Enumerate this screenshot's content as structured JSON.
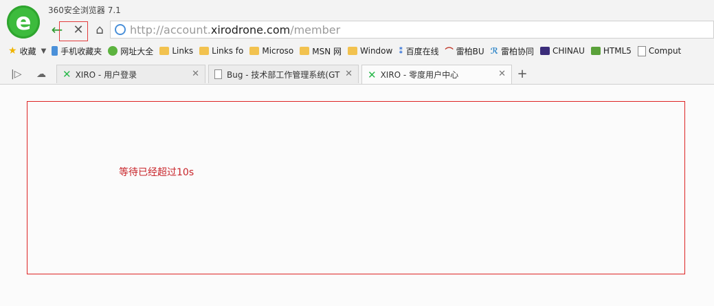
{
  "app": {
    "title": "360安全浏览器 7.1",
    "logo_letter": "e"
  },
  "nav": {
    "back_icon": "←",
    "stop_icon": "✕",
    "home_icon": "⌂"
  },
  "address": {
    "url_prefix": "http://account.",
    "url_domain": "xirodrone.com",
    "url_path": "/member"
  },
  "bookmarks": {
    "favorites_label": "收藏",
    "items": [
      {
        "label": "手机收藏夹",
        "icon": "phone-icon"
      },
      {
        "label": "网址大全",
        "icon": "globe-icon"
      },
      {
        "label": "Links",
        "icon": "folder-icon"
      },
      {
        "label": "Links fo",
        "icon": "folder-icon"
      },
      {
        "label": "Microso",
        "icon": "folder-icon"
      },
      {
        "label": "MSN 网",
        "icon": "folder-icon"
      },
      {
        "label": "Window",
        "icon": "folder-icon"
      },
      {
        "label": "百度在线",
        "icon": "baidu-icon"
      },
      {
        "label": "雷柏BU",
        "icon": "rapoo-icon"
      },
      {
        "label": "雷柏协同",
        "icon": "r-icon"
      },
      {
        "label": "CHINAU",
        "icon": "chinau-icon"
      },
      {
        "label": "HTML5",
        "icon": "ban-icon"
      },
      {
        "label": "Comput",
        "icon": "page-icon"
      }
    ]
  },
  "tabs": [
    {
      "label": "XIRO - 用户登录",
      "icon": "xiro-icon"
    },
    {
      "label": "Bug - 技术部工作管理系统(GT",
      "icon": "page-icon"
    },
    {
      "label": "XIRO - 零度用户中心",
      "icon": "xiro-icon"
    }
  ],
  "content": {
    "message": "等待已经超过10s"
  },
  "colors": {
    "accent": "#2e9a2e",
    "alert": "#d22222"
  }
}
